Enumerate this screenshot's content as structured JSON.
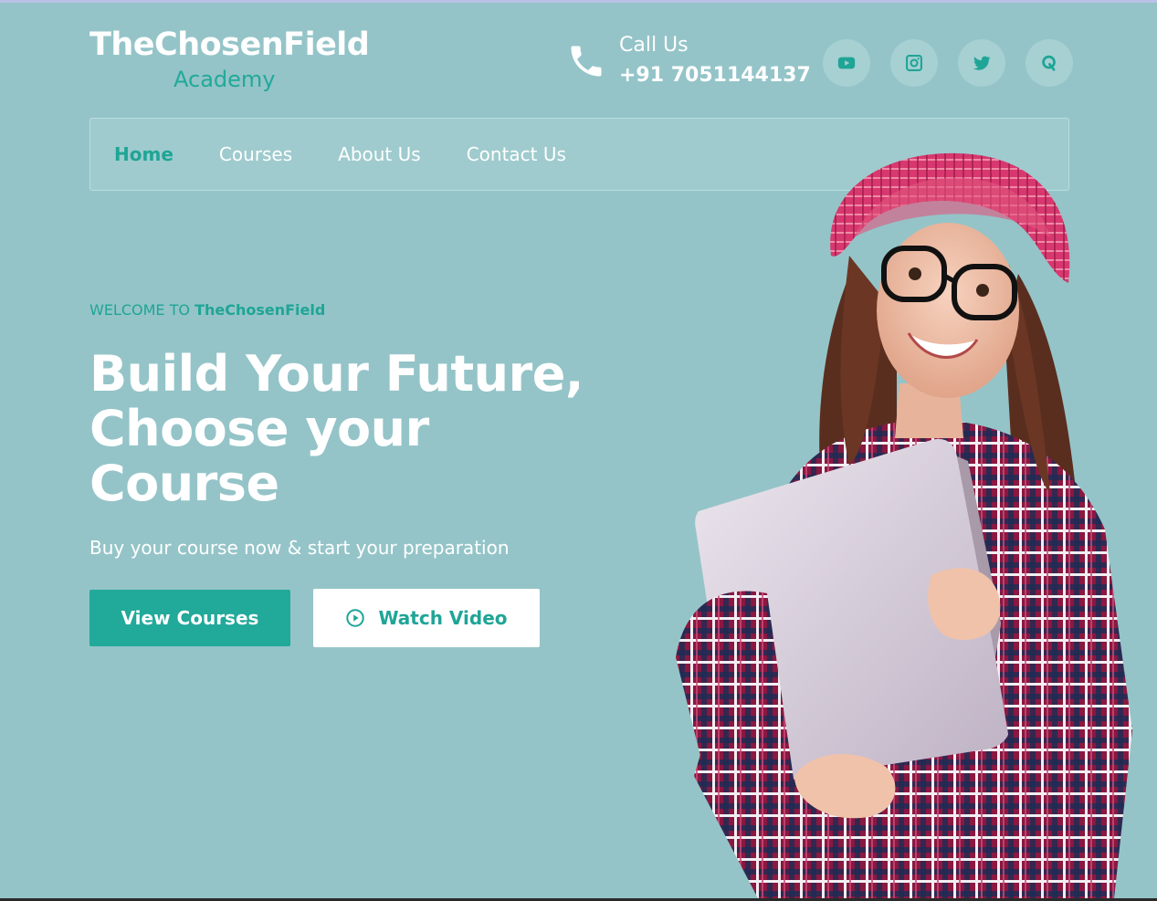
{
  "brand": {
    "name": "TheChosenField",
    "tagline": "Academy"
  },
  "contact": {
    "label": "Call Us",
    "phone": "+91 7051144137"
  },
  "social": [
    {
      "name": "youtube-icon"
    },
    {
      "name": "instagram-icon"
    },
    {
      "name": "twitter-icon"
    },
    {
      "name": "quora-icon"
    }
  ],
  "nav": {
    "items": [
      {
        "label": "Home",
        "active": true
      },
      {
        "label": "Courses",
        "active": false
      },
      {
        "label": "About Us",
        "active": false
      },
      {
        "label": "Contact Us",
        "active": false
      }
    ]
  },
  "hero": {
    "welcome_prefix": "WELCOME TO",
    "welcome_brand": "TheChosenField",
    "headline": "Build Your Future, Choose your Course",
    "subline": "Buy your course now & start your preparation",
    "primary_button": "View Courses",
    "secondary_button": "Watch Video"
  },
  "colors": {
    "background": "#94c4c8",
    "accent": "#21a99a",
    "white": "#ffffff"
  }
}
